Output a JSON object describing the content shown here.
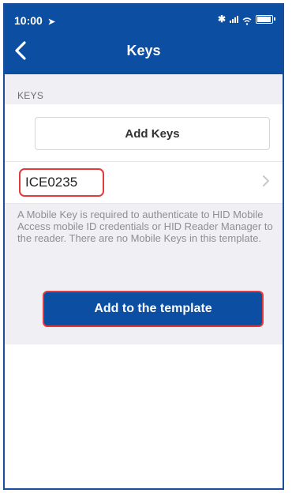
{
  "status_bar": {
    "time": "10:00"
  },
  "nav": {
    "title": "Keys"
  },
  "section": {
    "label": "KEYS"
  },
  "buttons": {
    "add_keys": "Add Keys",
    "add_to_template": "Add to the template"
  },
  "key_list": [
    {
      "name": "ICE0235"
    }
  ],
  "info_text": "A Mobile Key is required to authenticate to HID Mobile Access mobile ID credentials or HID Reader Manager to the reader. There are no Mobile Keys in this template.",
  "colors": {
    "brand_blue": "#0b4ea2",
    "highlight_red": "#e33b3b",
    "background_gray": "#efeff4",
    "secondary_text": "#8e8e93"
  },
  "icons": [
    "location-arrow-icon",
    "bluetooth-icon",
    "signal-icon",
    "wifi-icon",
    "battery-icon",
    "back-chevron-icon",
    "chevron-right-icon"
  ]
}
